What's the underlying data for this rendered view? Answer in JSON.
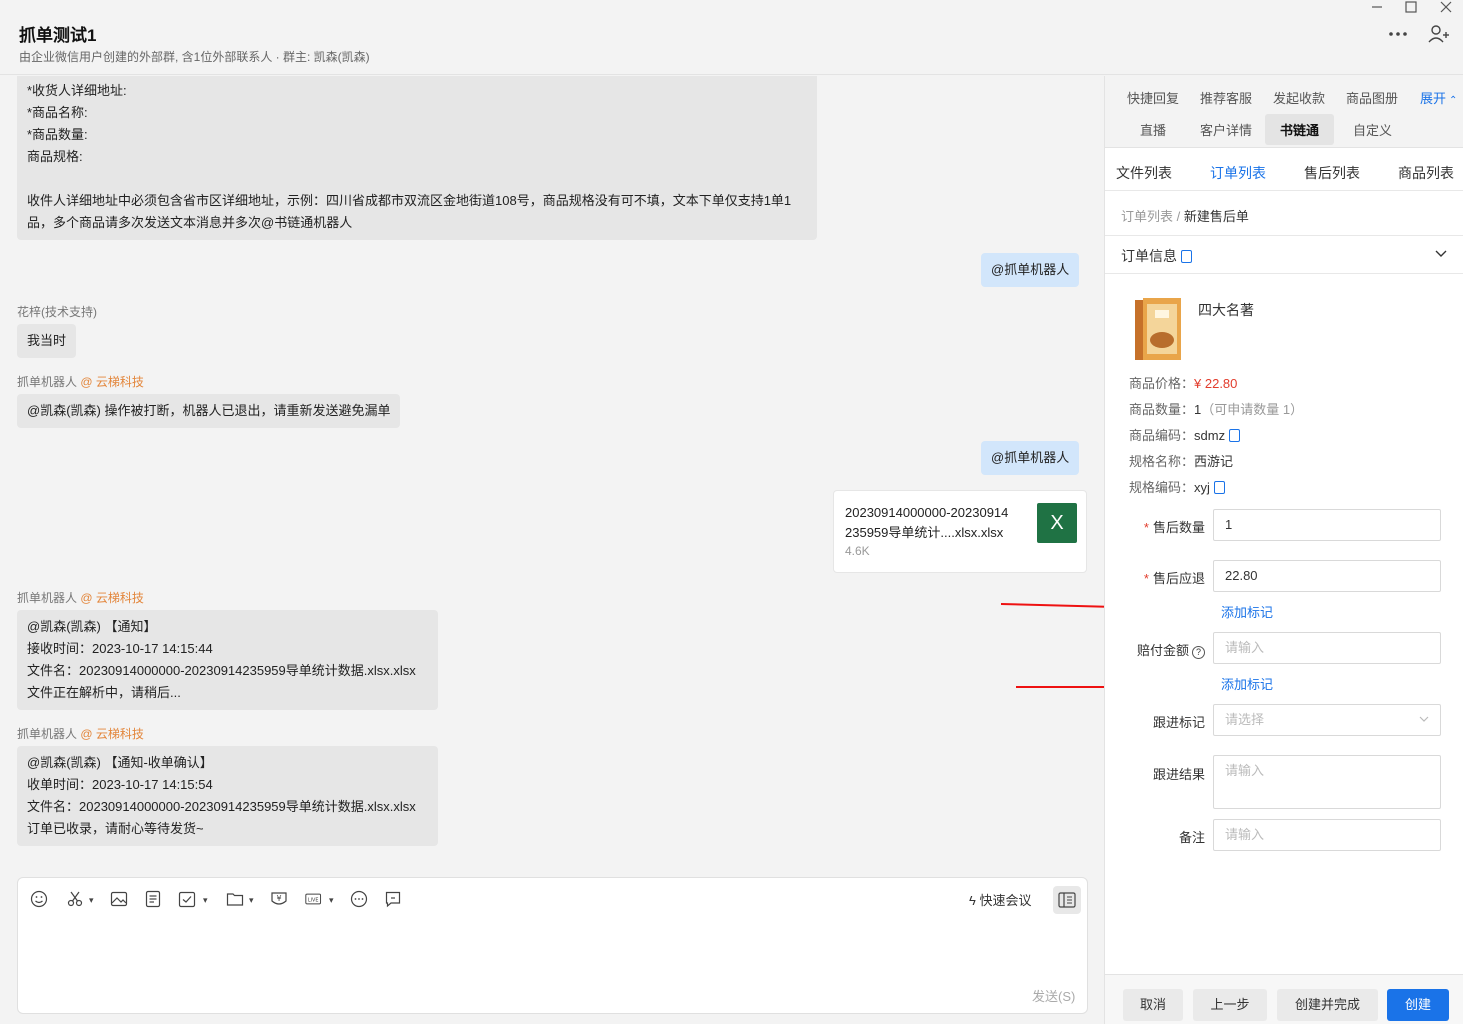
{
  "header": {
    "title": "抓单测试1",
    "subtitle": "由企业微信用户创建的外部群, 含1位外部联系人 · 群主: 凯森(凯森)"
  },
  "messages": {
    "form_template": {
      "lines": [
        "*收货人详细地址:",
        "*商品名称:",
        "*商品数量:",
        "商品规格:",
        "",
        "收件人详细地址中必须包含省市区详细地址，示例：四川省成都市双流区金地街道108号，商品规格没有可不填，文本下单仅支持1单1",
        "品，多个商品请多次发送文本消息并多次@书链通机器人"
      ]
    },
    "me1": "@抓单机器人",
    "sender1": "花梓(技术支持)",
    "msg1": "我当时",
    "sender2_name": "抓单机器人",
    "sender2_org": "@ 云梯科技",
    "msg2": "@凯森(凯森) 操作被打断，机器人已退出，请重新发送避免漏单",
    "me2": "@抓单机器人",
    "file": {
      "name_line1": "20230914000000-20230914",
      "name_line2": "235959导单统计....xlsx.xlsx",
      "size": "4.6K",
      "icon": "X"
    },
    "sender3_name": "抓单机器人",
    "sender3_org": "@ 云梯科技",
    "notice1": [
      "@凯森(凯森) 【通知】",
      "接收时间：2023-10-17 14:15:44",
      "文件名：20230914000000-20230914235959导单统计数据.xlsx.xlsx",
      "文件正在解析中，请稍后..."
    ],
    "sender4_name": "抓单机器人",
    "sender4_org": "@ 云梯科技",
    "notice2": [
      "@凯森(凯森) 【通知-收单确认】",
      "收单时间：2023-10-17 14:15:54",
      "文件名：20230914000000-20230914235959导单统计数据.xlsx.xlsx",
      "订单已收录，请耐心等待发货~"
    ]
  },
  "composer": {
    "quick_meeting": "快速会议",
    "send": "发送(S)"
  },
  "panel": {
    "tabs_row1": [
      "快捷回复",
      "推荐客服",
      "发起收款",
      "商品图册"
    ],
    "expand": "展开",
    "tabs_row2": [
      "直播",
      "客户详情",
      "书链通",
      "自定义"
    ],
    "subtabs": [
      "文件列表",
      "订单列表",
      "售后列表",
      "商品列表"
    ],
    "breadcrumb_parent": "订单列表",
    "breadcrumb_sep": " / ",
    "breadcrumb_current": "新建售后单",
    "section_title": "订单信息",
    "product": {
      "name": "四大名著",
      "price_label": "商品价格：",
      "price": "¥ 22.80",
      "qty_label": "商品数量：",
      "qty": "1",
      "qty_hint": "（可申请数量 1）",
      "code_label": "商品编码：",
      "code": "sdmz",
      "spec_label": "规格名称：",
      "spec": "西游记",
      "spec_code_label": "规格编码：",
      "spec_code": "xyj"
    },
    "form": {
      "after_qty_label": "售后数量",
      "after_qty_value": "1",
      "refund_label": "售后应退",
      "refund_value": "22.80",
      "add_tag": "添加标记",
      "comp_label": "赔付金额",
      "comp_placeholder": "请输入",
      "add_tag2": "添加标记",
      "follow_tag_label": "跟进标记",
      "follow_tag_placeholder": "请选择",
      "follow_result_label": "跟进结果",
      "follow_result_placeholder": "请输入",
      "remark_label": "备注",
      "remark_placeholder": "请输入"
    },
    "buttons": {
      "cancel": "取消",
      "prev": "上一步",
      "create_complete": "创建并完成",
      "create": "创建"
    }
  },
  "colors": {
    "accent": "#1a73e8",
    "price": "#e23c2c",
    "org": "#e3863b",
    "excel": "#1f7244",
    "arrow": "#ee1111"
  }
}
